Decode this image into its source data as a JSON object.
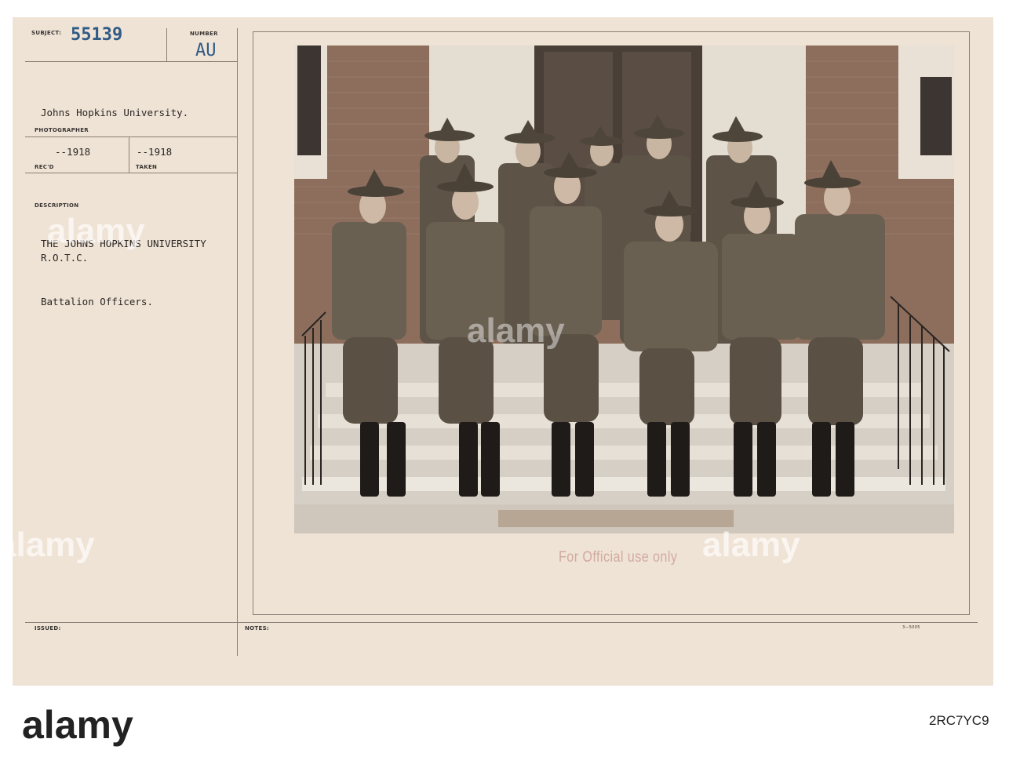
{
  "card": {
    "subject_label": "SUBJECT:",
    "subject_number": "55139",
    "number_label": "NUMBER",
    "number_code": "AU",
    "photographer_value": "Johns Hopkins University.",
    "photographer_label": "PHOTOGRAPHER",
    "recd_value": "--1918",
    "recd_label": "REC'D",
    "taken_value": "--1918",
    "taken_label": "TAKEN",
    "description_label": "DESCRIPTION",
    "description_line1": "THE JOHNS HOPKINS UNIVERSITY",
    "description_line2": "R.O.T.C.",
    "description_line3": "Battalion Officers.",
    "issued_label": "ISSUED:",
    "notes_label": "NOTES:",
    "form_code": "3—5005",
    "stamp": "For Official use only"
  },
  "photo": {
    "subject": "Twelve uniformed R.O.T.C. officers in campaign hats standing on building steps"
  },
  "watermark": {
    "text": "alamy"
  },
  "stock_bar": {
    "logo": "alamy",
    "image_id": "2RC7YC9"
  }
}
